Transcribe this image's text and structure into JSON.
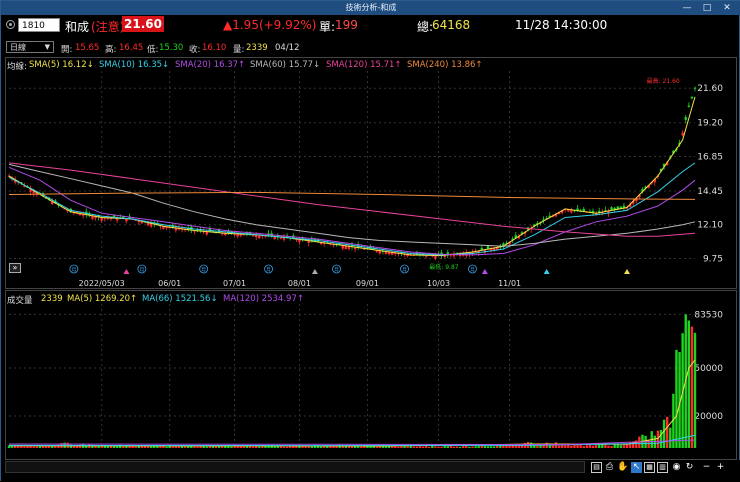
{
  "window": {
    "title": "技術分析-和成"
  },
  "quote": {
    "code": "1810",
    "name": "和成",
    "note": "(注意)",
    "price": "21.60",
    "change": "▲1.95(+9.92%)",
    "volume_label": "單:",
    "volume_value": "199",
    "total_label": "總:",
    "total_value": "64168",
    "datetime": "11/28 14:30:00"
  },
  "ohlc": {
    "period": "日線",
    "open_label": "開:",
    "open": "15.65",
    "high_label": "高:",
    "high": "16.45",
    "low_label": "低:",
    "low": "15.30",
    "close_label": "收:",
    "close": "16.10",
    "vol_label": "量:",
    "vol": "2339",
    "date": "04/12"
  },
  "price_legend": {
    "prefix": "均線:",
    "items": [
      {
        "text": "SMA(5) 16.12↓",
        "color": "#f2e24a"
      },
      {
        "text": "SMA(10) 16.35↓",
        "color": "#35d0e8"
      },
      {
        "text": "SMA(20) 16.37↑",
        "color": "#b04ce8"
      },
      {
        "text": "SMA(60) 15.77↓",
        "color": "#b8b8b8"
      },
      {
        "text": "SMA(120) 15.71↑",
        "color": "#e8439a"
      },
      {
        "text": "SMA(240) 13.86↑",
        "color": "#f08a3c"
      }
    ]
  },
  "volume_legend": {
    "prefix": "成交量",
    "value": "2339",
    "items": [
      {
        "text": "MA(5) 1269.20↑",
        "color": "#f2e24a"
      },
      {
        "text": "MA(66) 1521.56↓",
        "color": "#35d0e8"
      },
      {
        "text": "MA(120) 2534.97↑",
        "color": "#b04ce8"
      }
    ]
  },
  "annotations": {
    "high": "最高: 21.60",
    "low": "最低: 9.87",
    "badge": "月"
  },
  "colors": {
    "up": "#ff2a2a",
    "down": "#1ed41e",
    "axis": "#dddddd",
    "grid": "#333333"
  },
  "chart_data": [
    {
      "type": "line",
      "title": "",
      "x_ticks": [
        "2022/05/03",
        "06/01",
        "07/01",
        "08/01",
        "09/01",
        "10/03",
        "11/01"
      ],
      "y_ticks": [
        21.6,
        19.2,
        16.85,
        14.45,
        12.1,
        9.75
      ],
      "ylim": [
        8.6,
        22.8
      ],
      "grid": true,
      "series": [
        {
          "name": "SMA(5)",
          "color": "#f2e24a",
          "x": [
            0,
            10,
            20,
            30,
            40,
            50,
            60,
            70,
            80,
            90,
            100,
            110,
            120,
            130,
            140,
            150,
            160,
            170,
            180,
            190,
            200,
            210,
            218,
            222
          ],
          "values": [
            15.5,
            14.2,
            13.0,
            12.6,
            12.5,
            12.0,
            11.7,
            11.5,
            11.4,
            11.2,
            10.9,
            10.6,
            10.3,
            10.0,
            9.95,
            10.2,
            10.6,
            12.0,
            13.2,
            12.9,
            13.3,
            15.5,
            18.0,
            21.0
          ]
        },
        {
          "name": "SMA(10)",
          "color": "#35d0e8",
          "x": [
            0,
            10,
            20,
            30,
            40,
            50,
            60,
            70,
            80,
            90,
            100,
            110,
            120,
            130,
            140,
            150,
            160,
            170,
            180,
            190,
            200,
            210,
            218,
            222
          ],
          "values": [
            15.4,
            14.3,
            13.1,
            12.7,
            12.5,
            12.1,
            11.8,
            11.6,
            11.4,
            11.2,
            11.0,
            10.7,
            10.4,
            10.1,
            10.0,
            10.1,
            10.4,
            11.4,
            12.6,
            12.8,
            13.1,
            14.4,
            15.8,
            16.4
          ]
        },
        {
          "name": "SMA(20)",
          "color": "#b04ce8",
          "x": [
            0,
            10,
            20,
            30,
            40,
            50,
            60,
            70,
            80,
            90,
            100,
            110,
            120,
            130,
            140,
            150,
            160,
            170,
            180,
            190,
            200,
            210,
            218,
            222
          ],
          "values": [
            16.1,
            15.2,
            13.8,
            12.9,
            12.6,
            12.3,
            12.0,
            11.7,
            11.5,
            11.3,
            11.1,
            10.8,
            10.5,
            10.2,
            10.05,
            10.0,
            10.1,
            10.7,
            11.6,
            12.3,
            12.7,
            13.4,
            14.5,
            15.2
          ]
        },
        {
          "name": "SMA(60)",
          "color": "#b8b8b8",
          "x": [
            0,
            10,
            20,
            30,
            40,
            50,
            60,
            70,
            80,
            90,
            100,
            110,
            120,
            130,
            140,
            150,
            160,
            170,
            180,
            190,
            200,
            210,
            218,
            222
          ],
          "values": [
            16.3,
            15.8,
            15.3,
            14.8,
            14.3,
            13.6,
            13.0,
            12.5,
            12.1,
            11.8,
            11.5,
            11.2,
            11.0,
            10.9,
            10.8,
            10.7,
            10.6,
            10.8,
            11.1,
            11.3,
            11.5,
            11.8,
            12.1,
            12.3
          ]
        },
        {
          "name": "SMA(120)",
          "color": "#e8439a",
          "x": [
            0,
            20,
            40,
            60,
            80,
            100,
            120,
            140,
            160,
            180,
            200,
            210,
            222
          ],
          "values": [
            16.4,
            15.9,
            15.3,
            14.7,
            14.1,
            13.5,
            13.0,
            12.5,
            12.0,
            11.6,
            11.3,
            11.3,
            11.5
          ]
        },
        {
          "name": "SMA(240)",
          "color": "#f08a3c",
          "x": [
            0,
            40,
            80,
            120,
            160,
            200,
            222
          ],
          "values": [
            14.2,
            14.3,
            14.35,
            14.2,
            14.0,
            13.9,
            13.86
          ]
        }
      ]
    },
    {
      "type": "bar",
      "title": "",
      "y_ticks": [
        83530,
        50000,
        20000
      ],
      "ylim": [
        0,
        90000
      ],
      "grid": true,
      "series": [
        {
          "name": "成交量",
          "x": [
            0,
            10,
            20,
            30,
            40,
            50,
            60,
            70,
            80,
            90,
            100,
            110,
            120,
            130,
            140,
            150,
            160,
            170,
            180,
            190,
            200,
            205,
            210,
            214,
            217,
            219,
            222
          ],
          "values": [
            1500,
            1200,
            2800,
            1600,
            1400,
            1300,
            1200,
            1500,
            1300,
            1200,
            1500,
            1400,
            1300,
            1200,
            1100,
            1300,
            1700,
            3500,
            2200,
            1700,
            2500,
            6000,
            10000,
            18000,
            60000,
            83530,
            72000
          ]
        }
      ]
    }
  ]
}
